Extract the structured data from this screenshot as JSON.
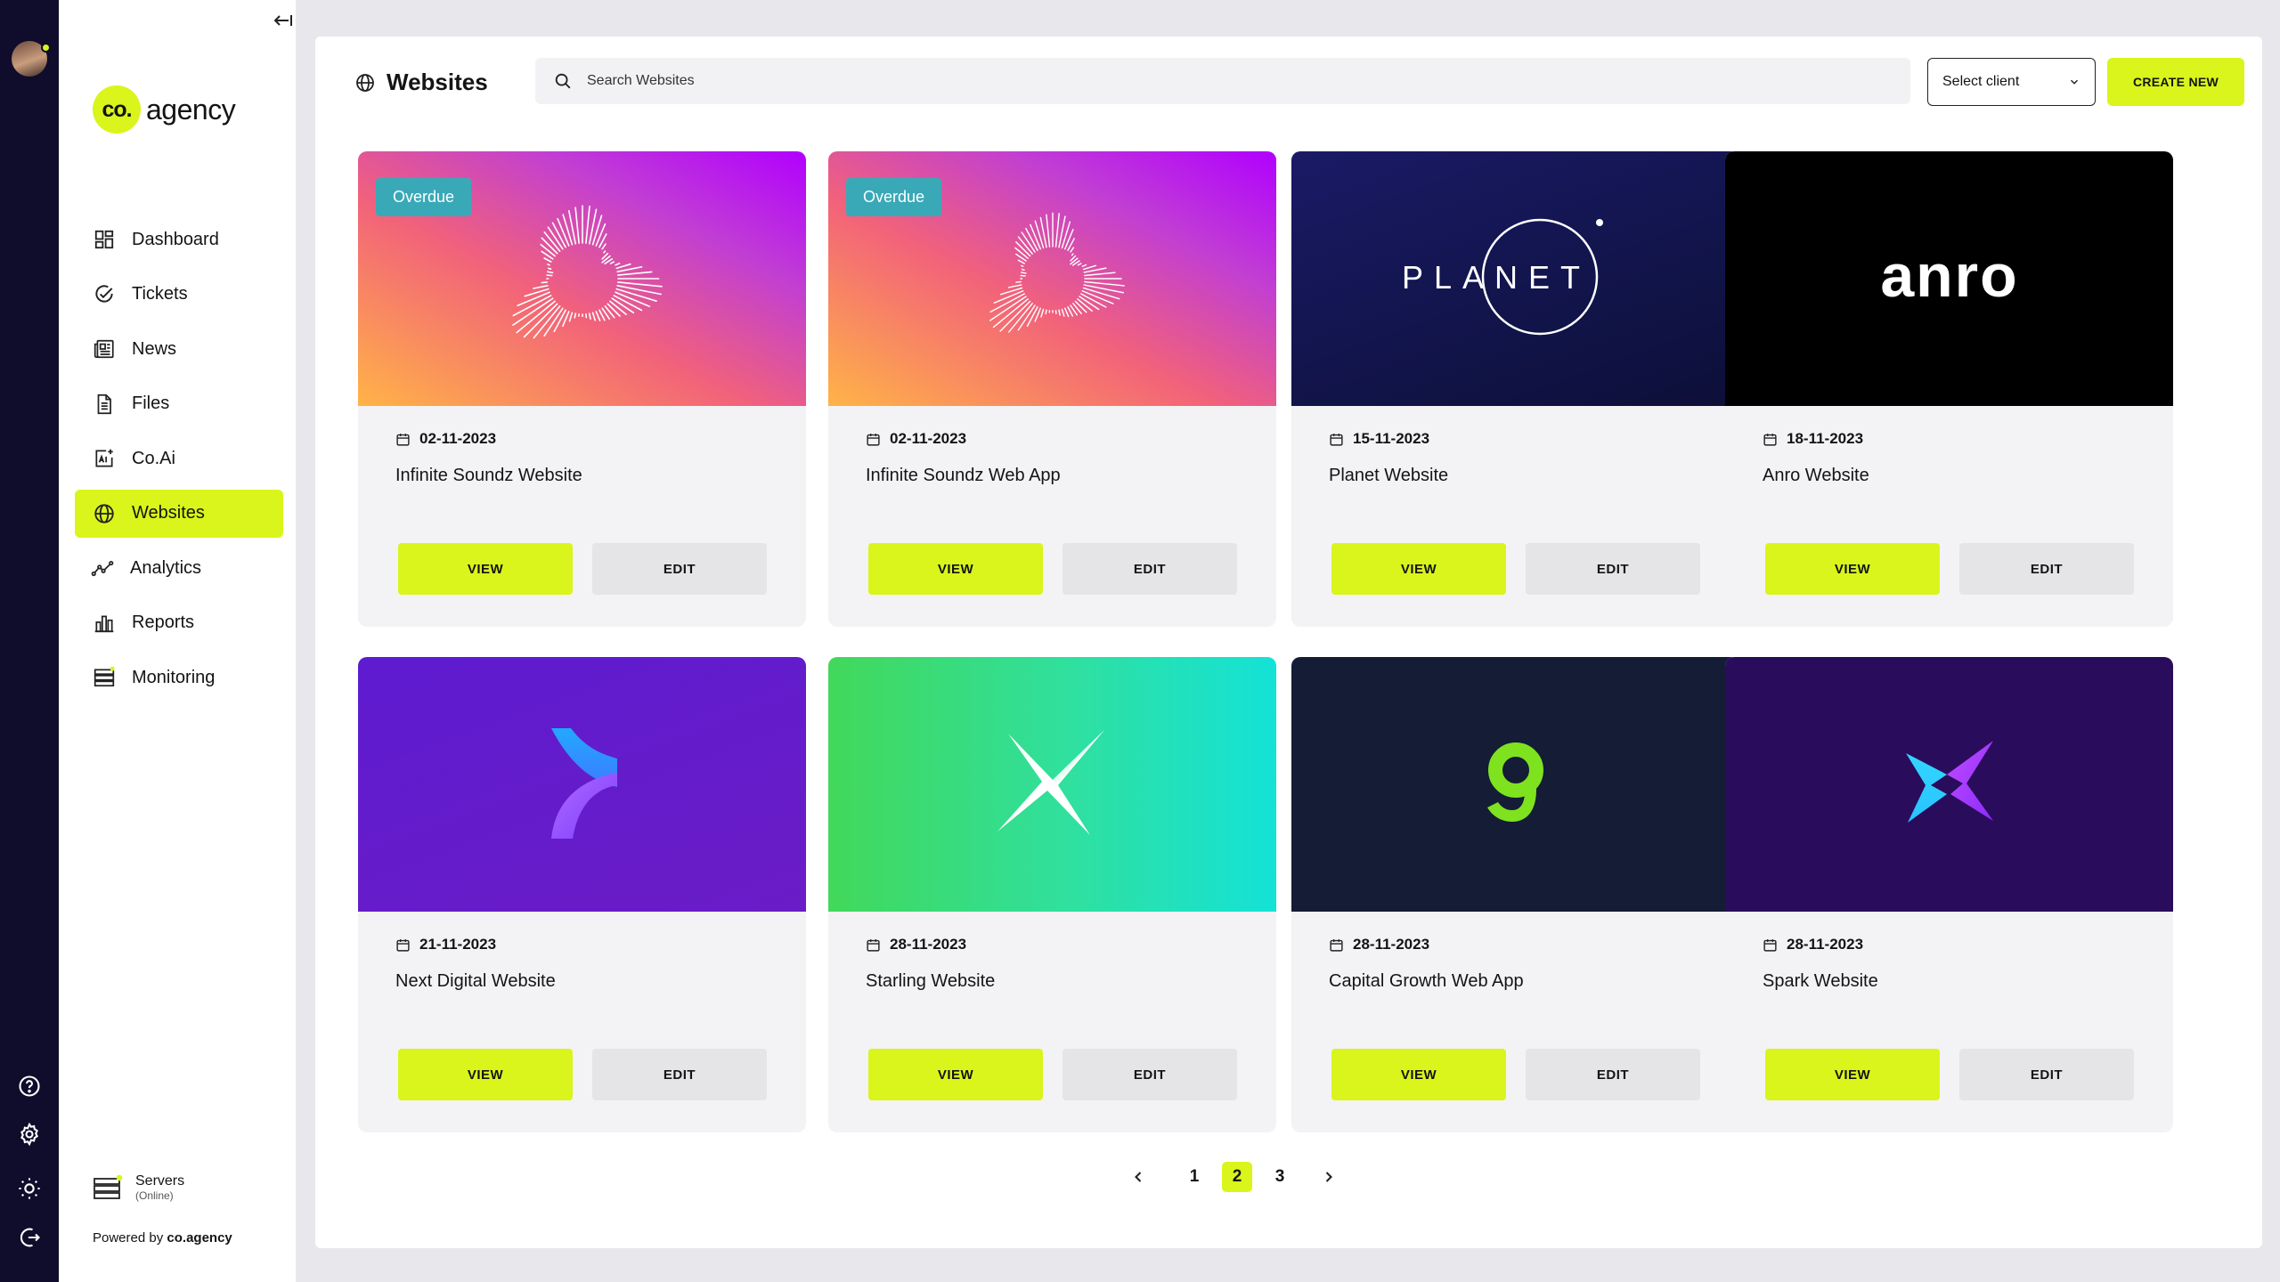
{
  "app": {
    "brand_mark": "co.",
    "brand_name": "agency"
  },
  "nav": [
    {
      "label": "Dashboard",
      "icon": "dashboard-icon"
    },
    {
      "label": "Tickets",
      "icon": "check-circle-icon"
    },
    {
      "label": "News",
      "icon": "newspaper-icon"
    },
    {
      "label": "Files",
      "icon": "file-icon"
    },
    {
      "label": "Co.Ai",
      "icon": "ai-icon"
    },
    {
      "label": "Websites",
      "icon": "globe-icon",
      "active": true
    },
    {
      "label": "Analytics",
      "icon": "analytics-icon"
    },
    {
      "label": "Reports",
      "icon": "bar-chart-icon"
    },
    {
      "label": "Monitoring",
      "icon": "server-stack-icon"
    }
  ],
  "servers": {
    "title": "Servers",
    "status": "(Online)"
  },
  "powered": {
    "prefix": "Powered by",
    "brand": "co.agency"
  },
  "header": {
    "title": "Websites",
    "search_placeholder": "Search Websites",
    "select_client": "Select client",
    "create_label": "CREATE NEW"
  },
  "cards": [
    {
      "date": "02-11-2023",
      "title": "Infinite Soundz Website",
      "badge": "Overdue",
      "view": "VIEW",
      "edit": "EDIT",
      "logo": "planet-burst"
    },
    {
      "date": "02-11-2023",
      "title": "Infinite Soundz Web App",
      "badge": "Overdue",
      "view": "VIEW",
      "edit": "EDIT",
      "logo": "planet-burst"
    },
    {
      "date": "15-11-2023",
      "title": "Planet Website",
      "badge": "",
      "view": "VIEW",
      "edit": "EDIT",
      "logo_text": "PLANET"
    },
    {
      "date": "18-11-2023",
      "title": "Anro Website",
      "badge": "",
      "view": "VIEW",
      "edit": "EDIT",
      "logo_text": "anro"
    },
    {
      "date": "21-11-2023",
      "title": "Next Digital Website",
      "badge": "",
      "view": "VIEW",
      "edit": "EDIT",
      "logo": "next-digital-logo"
    },
    {
      "date": "28-11-2023",
      "title": "Starling Website",
      "badge": "",
      "view": "VIEW",
      "edit": "EDIT",
      "logo": "starling-logo"
    },
    {
      "date": "28-11-2023",
      "title": "Capital Growth Web App",
      "badge": "",
      "view": "VIEW",
      "edit": "EDIT",
      "logo": "capital-growth-logo"
    },
    {
      "date": "28-11-2023",
      "title": "Spark Website",
      "badge": "",
      "view": "VIEW",
      "edit": "EDIT",
      "logo": "spark-logo"
    }
  ],
  "pagination": {
    "pages": [
      "1",
      "2",
      "3"
    ],
    "current": "2"
  },
  "colors": {
    "accent": "#d9f51b",
    "rail": "#0f0d2b",
    "badge": "#3aa9b7"
  }
}
